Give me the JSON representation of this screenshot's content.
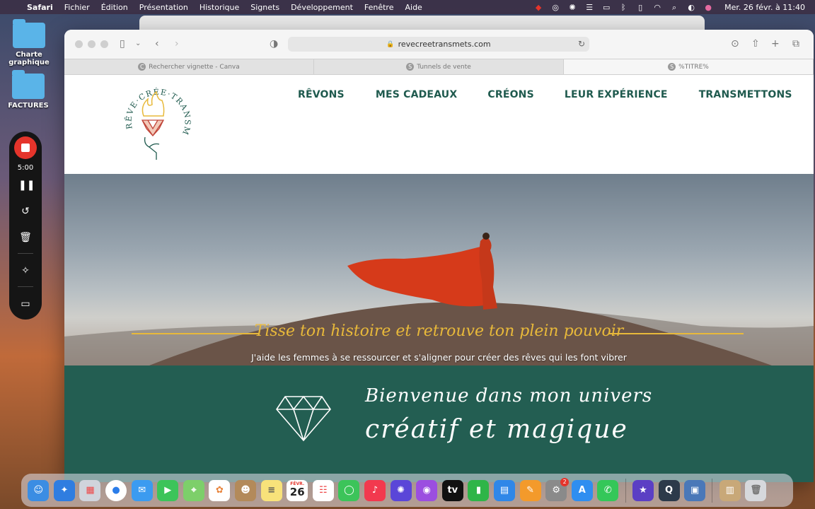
{
  "menubar": {
    "app": "Safari",
    "items": [
      "Fichier",
      "Édition",
      "Présentation",
      "Historique",
      "Signets",
      "Développement",
      "Fenêtre",
      "Aide"
    ],
    "clock": "Mer. 26 févr. à  11:40"
  },
  "desktop": {
    "folders": [
      "Charte graphique",
      "FACTURES"
    ]
  },
  "recorder": {
    "time": "5:00"
  },
  "browser": {
    "url": "revecreetransmets.com",
    "tabs": [
      {
        "label": "Rechercher vignette - Canva",
        "favicon": "C"
      },
      {
        "label": "Tunnels de vente",
        "favicon": "S"
      },
      {
        "label": "%TITRE%",
        "favicon": "S"
      }
    ]
  },
  "site": {
    "logo_text": "RÊVE·CRÉE·TRANSMETS",
    "nav": [
      "RÊVONS",
      "MES CADEAUX",
      "CRÉONS",
      "LEUR EXPÉRIENCE",
      "TRANSMETTONS"
    ],
    "hero_tagline": "Tisse ton histoire et retrouve ton plein pouvoir",
    "hero_subline": "J'aide les femmes à se ressourcer et s'aligner pour créer des rêves qui les font vibrer",
    "welcome_line1": "Bienvenue dans mon univers",
    "welcome_line2": "créatif et magique"
  },
  "dock": {
    "calendar_month": "FÉVR.",
    "calendar_day": "26",
    "settings_badge": "2"
  }
}
